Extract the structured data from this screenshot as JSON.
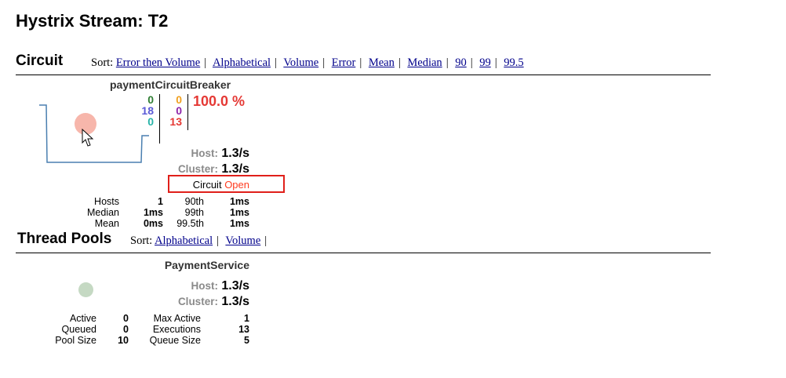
{
  "page_title": "Hystrix Stream: T2",
  "circuit_section": {
    "title": "Circuit",
    "sort_label": "Sort:",
    "sort_links": [
      "Error then Volume",
      "Alphabetical",
      "Volume",
      "Error",
      "Mean",
      "Median",
      "90",
      "99",
      "99.5"
    ],
    "name": "paymentCircuitBreaker",
    "counts": {
      "success": "0",
      "short_circuited": "18",
      "bad_request": "0",
      "timeout": "0",
      "rejected": "0",
      "failure": "13"
    },
    "error_pct": "100.0 %",
    "host_label": "Host:",
    "host_value": "1.3/s",
    "cluster_label": "Cluster:",
    "cluster_value": "1.3/s",
    "circuit_label": "Circuit",
    "circuit_status": "Open",
    "stats": {
      "hosts_label": "Hosts",
      "hosts_value": "1",
      "median_label": "Median",
      "median_value": "1ms",
      "mean_label": "Mean",
      "mean_value": "0ms",
      "p90_label": "90th",
      "p90_value": "1ms",
      "p99_label": "99th",
      "p99_value": "1ms",
      "p995_label": "99.5th",
      "p995_value": "1ms"
    },
    "colors": {
      "success": "#2e7d32",
      "short": "#5a5ad6",
      "bad": "#26b3a8",
      "timeout": "#f0a020",
      "rejected": "#8e24aa",
      "failure": "#e53935",
      "open": "#ff3b1f",
      "circle": "#f7b6ab"
    }
  },
  "thread_section": {
    "title": "Thread Pools",
    "sort_label": "Sort:",
    "sort_links": [
      "Alphabetical",
      "Volume"
    ],
    "name": "PaymentService",
    "host_label": "Host:",
    "host_value": "1.3/s",
    "cluster_label": "Cluster:",
    "cluster_value": "1.3/s",
    "stats": {
      "active_label": "Active",
      "active_value": "0",
      "queued_label": "Queued",
      "queued_value": "0",
      "pool_size_label": "Pool Size",
      "pool_size_value": "10",
      "max_active_label": "Max Active",
      "max_active_value": "1",
      "executions_label": "Executions",
      "executions_value": "13",
      "queue_size_label": "Queue Size",
      "queue_size_value": "5"
    },
    "colors": {
      "circle": "#c5d9c3"
    }
  }
}
